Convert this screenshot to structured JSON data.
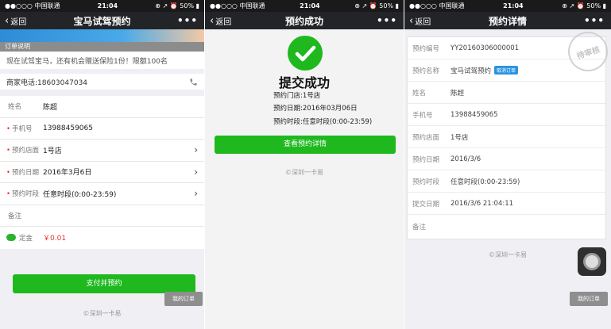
{
  "status": {
    "carrier": "●●○○○ 中国联通 ",
    "time": "21:04",
    "battery": "⊕ ↗ ⏰ 50% ▮"
  },
  "screen1": {
    "back_label": "返回",
    "title": "宝马试驾预约",
    "more": "•••",
    "section_header": "订单说明",
    "notice": "现在试驾宝马，还有机会赠送保险1份！限额100名",
    "merchant_phone": "商家电话:18603047034",
    "fields": [
      {
        "label": "姓名",
        "required": "",
        "value": "陈超"
      },
      {
        "label": "手机号",
        "required": "•",
        "value": "13988459065"
      },
      {
        "label": "预约店面",
        "required": "•",
        "value": "1号店"
      },
      {
        "label": "预约日期",
        "required": "•",
        "value": "2016年3月6日"
      },
      {
        "label": "预约时段",
        "required": "•",
        "value": "任意时段(0:00-23:59)"
      },
      {
        "label": "备注",
        "required": "",
        "value": ""
      }
    ],
    "deposit_label": "定金",
    "deposit_value": "￥0.01",
    "pay_button": "支付并预约",
    "my_orders": "我的订单",
    "brand": "©深圳一卡易"
  },
  "screen2": {
    "back_label": "返回",
    "title": "预约成功",
    "more": "•••",
    "success_title": "提交成功",
    "store": "预约门店:1号店",
    "date": "预约日期:2016年03月06日",
    "period": "预约时段:任意时段(0:00-23:59)",
    "detail_button": "查看预约详情",
    "brand": "©深圳一卡易"
  },
  "screen3": {
    "back_label": "返回",
    "title": "预约详情",
    "more": "•••",
    "stamp": "待审核",
    "rows": [
      {
        "label": "预约编号",
        "value": "YY20160306000001"
      },
      {
        "label": "预约名称",
        "value": "宝马试驾预约"
      },
      {
        "label": "姓名",
        "value": "陈超"
      },
      {
        "label": "手机号",
        "value": "13988459065"
      },
      {
        "label": "预约店面",
        "value": "1号店"
      },
      {
        "label": "预约日期",
        "value": "2016/3/6"
      },
      {
        "label": "预约时段",
        "value": "任意时段(0:00-23:59)"
      },
      {
        "label": "提交日期",
        "value": "2016/3/6 21:04:11"
      },
      {
        "label": "备注",
        "value": ""
      }
    ],
    "cancel_tag": "取消订单",
    "brand": "©深圳一卡易",
    "my_orders": "我的订单"
  },
  "colors": {
    "green": "#1fb91f",
    "navbar": "#222428",
    "blue_tag": "#2a93e0"
  }
}
